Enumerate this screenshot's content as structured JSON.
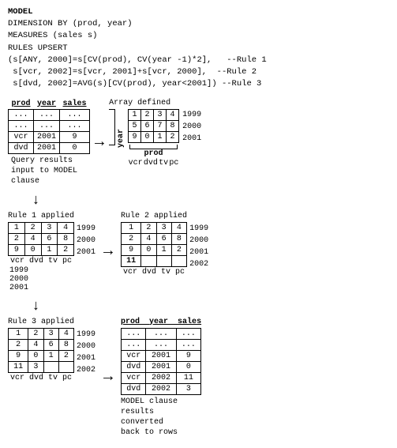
{
  "code": {
    "line1": "MODEL",
    "line2": "DIMENSION BY (prod, year)",
    "line3": "MEASURES (sales s)",
    "line4": "RULES UPSERT",
    "line5": "(s[ANY, 2000]=s[CV(prod), CV(year -1)*2],   --Rule 1",
    "line6": " s[vcr, 2002]=s[vcr, 2001]+s[vcr, 2000],  --Rule 2",
    "line7": " s[dvd, 2002]=AVG(s)[CV(prod), year<2001]) --Rule 3"
  },
  "query_table": {
    "headers": [
      "prod",
      "year",
      "sales"
    ],
    "rows": [
      [
        "...",
        "...",
        "..."
      ],
      [
        "...",
        "...",
        "..."
      ],
      [
        "vcr",
        "2001",
        "9"
      ],
      [
        "dvd",
        "2001",
        "0"
      ]
    ]
  },
  "array_table": {
    "cols": [
      "1",
      "2",
      "3",
      "4"
    ],
    "rows": [
      [
        "1",
        "2",
        "3",
        "4"
      ],
      [
        "5",
        "6",
        "7",
        "8"
      ],
      [
        "9",
        "0",
        "1",
        "2"
      ]
    ],
    "years": [
      "1999",
      "2000",
      "2001"
    ],
    "prod_labels": [
      "vcr",
      "dvd",
      "tv",
      "pc"
    ],
    "title": "Array defined",
    "year_label": "year",
    "prod_label": "prod"
  },
  "rule1_table": {
    "rows": [
      [
        "1",
        "2",
        "3",
        "4"
      ],
      [
        "2",
        "4",
        "6",
        "8"
      ],
      [
        "9",
        "0",
        "1",
        "2"
      ]
    ],
    "years": [
      "1999",
      "2000",
      "2001"
    ],
    "prod_labels": [
      "vcr",
      "dvd",
      "tv",
      "pc"
    ],
    "title": "Rule 1 applied"
  },
  "rule2_table": {
    "rows": [
      [
        "1",
        "2",
        "3",
        "4"
      ],
      [
        "2",
        "4",
        "6",
        "8"
      ],
      [
        "9",
        "0",
        "1",
        "2"
      ],
      [
        "11",
        "",
        "",
        ""
      ]
    ],
    "years": [
      "1999",
      "2000",
      "2001",
      "2002"
    ],
    "prod_labels": [
      "vcr",
      "dvd",
      "tv",
      "pc"
    ],
    "title": "Rule 2 applied"
  },
  "rule3_table": {
    "rows": [
      [
        "1",
        "2",
        "3",
        "4"
      ],
      [
        "2",
        "4",
        "6",
        "8"
      ],
      [
        "9",
        "0",
        "1",
        "2"
      ],
      [
        "11",
        "3",
        "",
        ""
      ]
    ],
    "years": [
      "1999",
      "2000",
      "2001",
      "2002"
    ],
    "prod_labels": [
      "vcr",
      "dvd",
      "tv",
      "pc"
    ],
    "title": "Rule 3 applied"
  },
  "result_table": {
    "headers": [
      "prod",
      "year",
      "sales"
    ],
    "rows": [
      [
        "...",
        "...",
        "..."
      ],
      [
        "...",
        "...",
        "..."
      ],
      [
        "vcr",
        "2001",
        "9"
      ],
      [
        "dvd",
        "2001",
        "0"
      ],
      [
        "vcr",
        "2002",
        "11"
      ],
      [
        "dvd",
        "2002",
        "3"
      ]
    ],
    "title": "prod  year  sales",
    "annot": "MODEL clause\nresults\nconverted\nback to rows"
  },
  "labels": {
    "query_annot": "Query results\ninput to MODEL\nclause",
    "rule1_title": "Rule 1 applied",
    "rule2_title": "Rule 2 applied",
    "rule3_title": "Rule 3 applied",
    "array_title": "Array defined",
    "result_title": "prod year sales",
    "model_annot": "MODEL clause\nresults\nconverted\nback to rows"
  }
}
